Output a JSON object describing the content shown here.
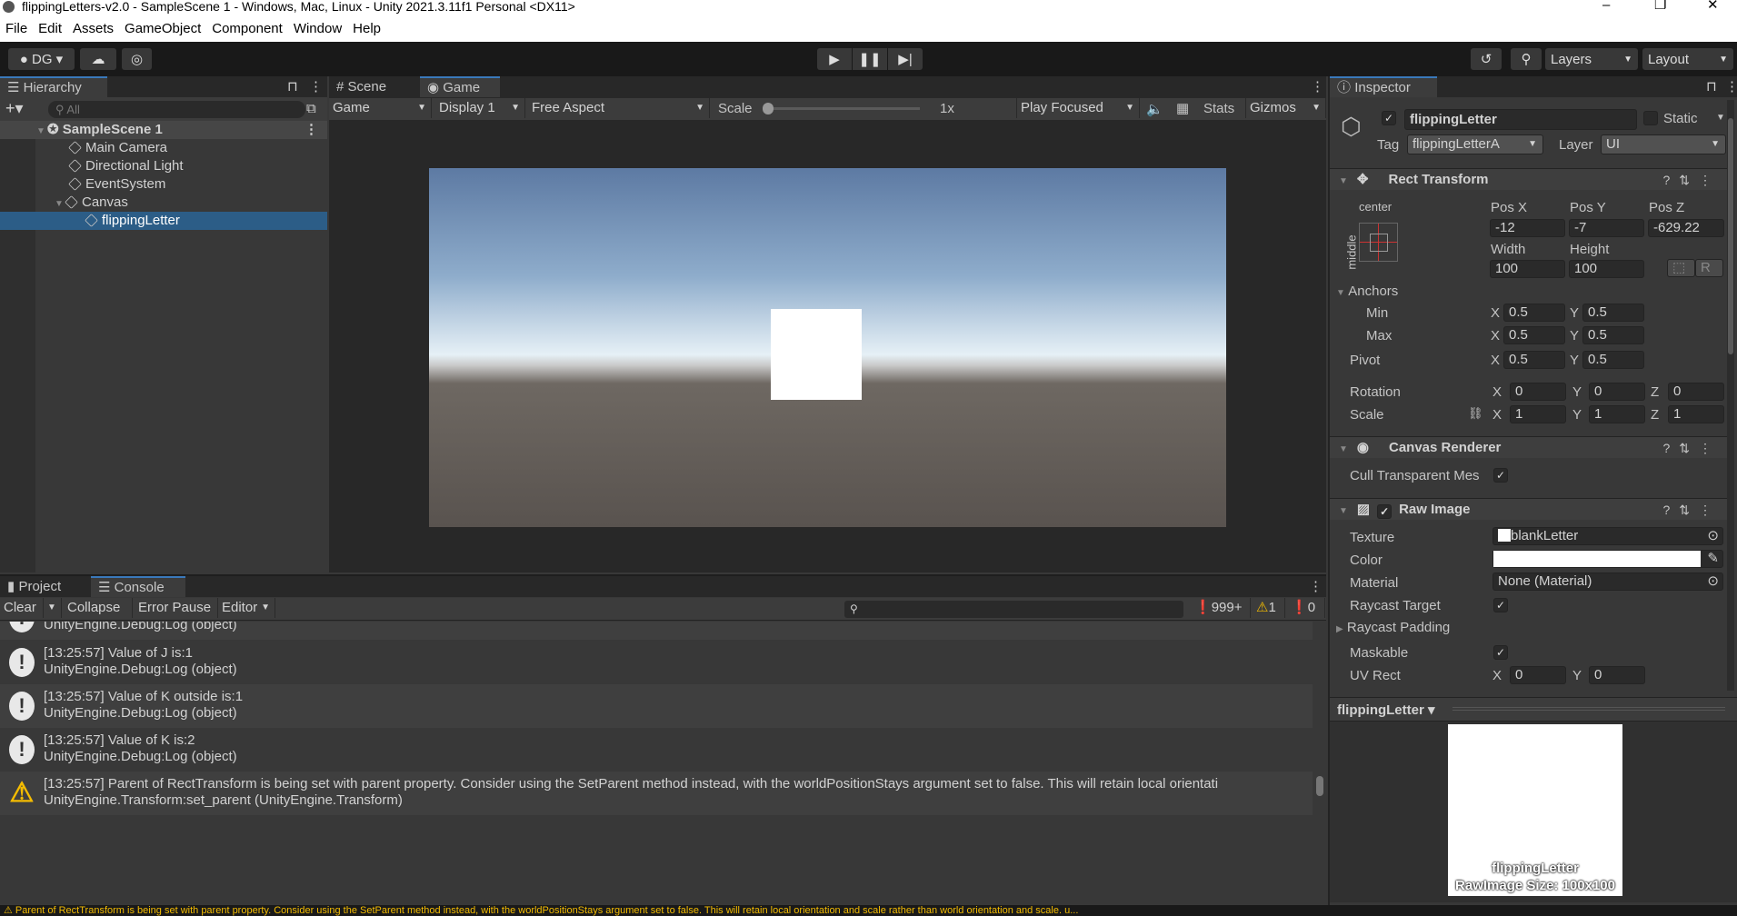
{
  "window": {
    "title": "flippingLetters-v2.0 - SampleScene 1 - Windows, Mac, Linux - Unity 2021.3.11f1 Personal <DX11>",
    "minimize": "–",
    "maximize": "❐",
    "close": "✕"
  },
  "menu": [
    "File",
    "Edit",
    "Assets",
    "GameObject",
    "Component",
    "Window",
    "Help"
  ],
  "toolbar": {
    "account": "DG",
    "layers": "Layers",
    "layout": "Layout"
  },
  "hierarchy": {
    "tab": "Hierarchy",
    "search_placeholder": "All",
    "scene": "SampleScene 1",
    "items": [
      "Main Camera",
      "Directional Light",
      "EventSystem",
      "Canvas",
      "flippingLetter"
    ]
  },
  "game": {
    "tabs": [
      "Scene",
      "Game"
    ],
    "view_mode": "Game",
    "display": "Display 1",
    "aspect": "Free Aspect",
    "scale_label": "Scale",
    "scale_value": "1x",
    "play_mode": "Play Focused",
    "stats": "Stats",
    "gizmos": "Gizmos"
  },
  "inspector": {
    "tab": "Inspector",
    "name": "flippingLetter",
    "active": true,
    "static_label": "Static",
    "tag_label": "Tag",
    "tag": "flippingLetterA",
    "layer_label": "Layer",
    "layer": "UI",
    "rect": {
      "title": "Rect Transform",
      "anchor_h": "center",
      "anchor_v": "middle",
      "pos_x_label": "Pos X",
      "pos_y_label": "Pos Y",
      "pos_z_label": "Pos Z",
      "pos_x": "-12",
      "pos_y": "-7",
      "pos_z": "-629.22",
      "width_label": "Width",
      "height_label": "Height",
      "width": "100",
      "height": "100",
      "r_btn": "R",
      "anchors": "Anchors",
      "min": "Min",
      "max": "Max",
      "pivot": "Pivot",
      "min_x": "0.5",
      "min_y": "0.5",
      "max_x": "0.5",
      "max_y": "0.5",
      "pivot_x": "0.5",
      "pivot_y": "0.5",
      "rotation": "Rotation",
      "rot_x": "0",
      "rot_y": "0",
      "rot_z": "0",
      "scale": "Scale",
      "scale_x": "1",
      "scale_y": "1",
      "scale_z": "1",
      "x": "X",
      "y": "Y",
      "z": "Z"
    },
    "canvas_renderer": {
      "title": "Canvas Renderer",
      "cull_label": "Cull Transparent Mes"
    },
    "raw_image": {
      "title": "Raw Image",
      "texture_label": "Texture",
      "texture": "blankLetter",
      "color_label": "Color",
      "color": "#ffffff",
      "material_label": "Material",
      "material": "None (Material)",
      "raycast_target": "Raycast Target",
      "raycast_padding": "Raycast Padding",
      "maskable": "Maskable",
      "uv_rect": "UV Rect",
      "uv_x": "0",
      "uv_y": "0"
    },
    "preview": {
      "title": "flippingLetter",
      "caption1": "flippingLetter",
      "caption2": "RawImage Size: 100x100"
    }
  },
  "console": {
    "tabs": [
      "Project",
      "Console"
    ],
    "clear": "Clear",
    "collapse": "Collapse",
    "error_pause": "Error Pause",
    "editor": "Editor",
    "log_count": "999+",
    "warn_count": "1",
    "error_count": "0",
    "entries": [
      {
        "type": "log",
        "line1": "",
        "line2": "UnityEngine.Debug:Log (object)"
      },
      {
        "type": "log",
        "line1": "[13:25:57] Value of J is:1",
        "line2": "UnityEngine.Debug:Log (object)"
      },
      {
        "type": "log",
        "line1": "[13:25:57] Value of K outside is:1",
        "line2": "UnityEngine.Debug:Log (object)"
      },
      {
        "type": "log",
        "line1": "[13:25:57] Value of K is:2",
        "line2": "UnityEngine.Debug:Log (object)"
      },
      {
        "type": "warning",
        "line1": "[13:25:57] Parent of RectTransform is being set with parent property. Consider using the SetParent method instead, with the worldPositionStays argument set to false. This will retain local orientati",
        "line2": "UnityEngine.Transform:set_parent (UnityEngine.Transform)"
      }
    ]
  },
  "status": {
    "message": "Parent of RectTransform is being set with parent property. Consider using the SetParent method instead, with the worldPositionStays argument set to false. This will retain local orientation and scale rather than world orientation and scale. u..."
  },
  "colors": {
    "selection": "#2c5d87",
    "warning": "#f4bc02",
    "accent": "#3a79bb"
  }
}
